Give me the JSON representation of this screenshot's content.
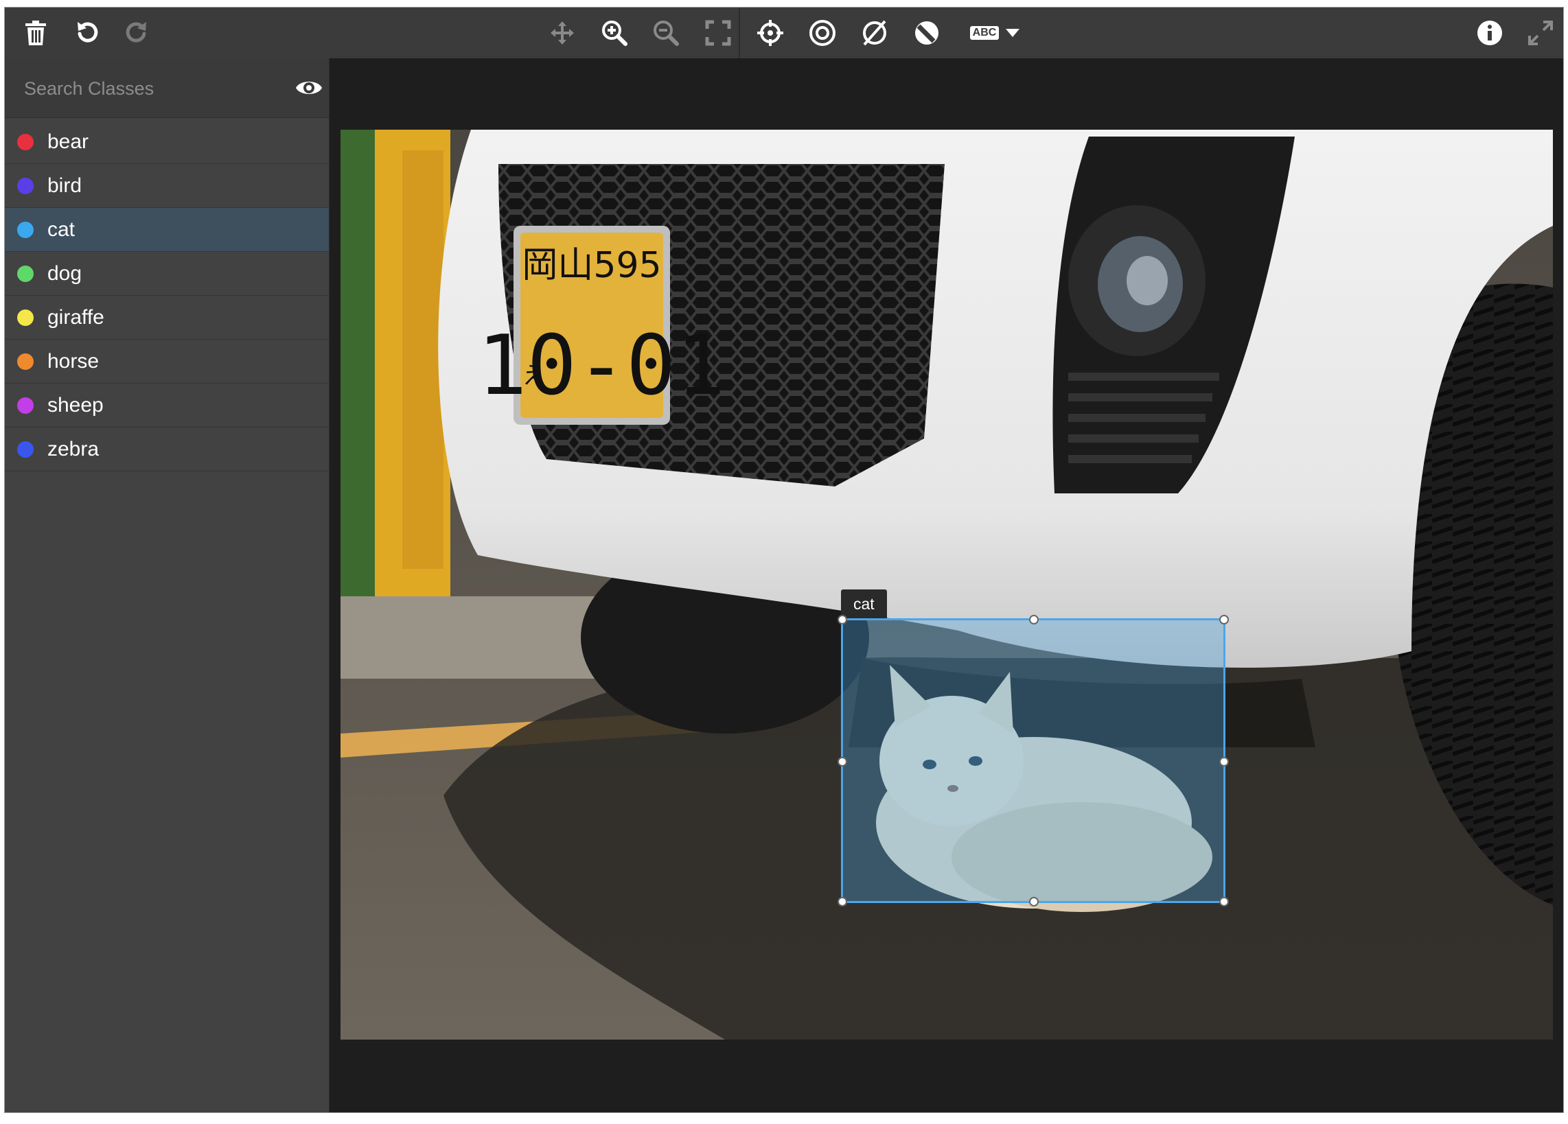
{
  "toolbar": {
    "tools_left": [
      "delete-icon",
      "undo-icon",
      "redo-icon"
    ],
    "tools_center": [
      "pan-icon",
      "zoom-in-icon",
      "zoom-out-icon",
      "fit-screen-icon",
      "crosshair-icon",
      "show-annotations-icon",
      "hide-annotations-icon",
      "toggle-mask-icon",
      "label-mode-icon"
    ],
    "label_mode_text": "ABC",
    "tools_right": [
      "info-icon",
      "fullscreen-icon"
    ]
  },
  "sidebar": {
    "search_placeholder": "Search Classes",
    "search_value": "",
    "classes": [
      {
        "label": "bear",
        "color": "#e8303f",
        "selected": false
      },
      {
        "label": "bird",
        "color": "#5a3fe8",
        "selected": false
      },
      {
        "label": "cat",
        "color": "#3aa8ee",
        "selected": true
      },
      {
        "label": "dog",
        "color": "#5fd86a",
        "selected": false
      },
      {
        "label": "giraffe",
        "color": "#f5e64a",
        "selected": false
      },
      {
        "label": "horse",
        "color": "#f08a2e",
        "selected": false
      },
      {
        "label": "sheep",
        "color": "#c23ee8",
        "selected": false
      },
      {
        "label": "zebra",
        "color": "#3a56ee",
        "selected": false
      }
    ]
  },
  "annotation": {
    "label": "cat",
    "color": "#4aa6ec"
  },
  "license_plate": {
    "top_text": "岡山595",
    "number": "10-01",
    "prefix": "え"
  }
}
